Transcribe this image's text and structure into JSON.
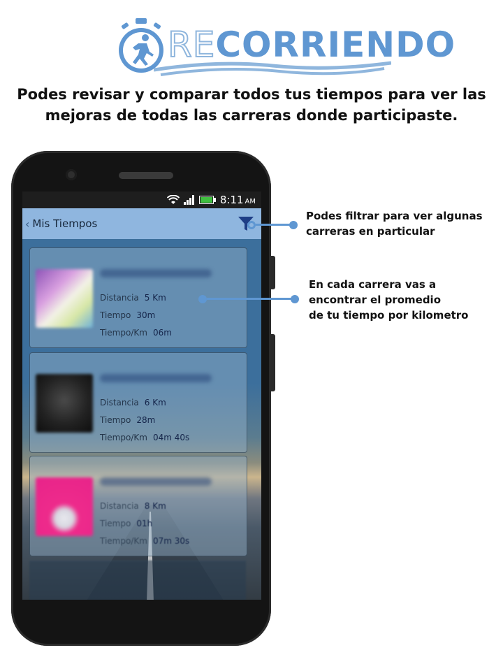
{
  "logo": {
    "text_re": "RE",
    "text_main": "CORRIENDO",
    "icon": "stopwatch-runner-icon",
    "brand_color": "#5f97d2"
  },
  "headline": "Podes revisar y comparar todos tus tiempos para ver las mejoras de todas las carreras donde participaste.",
  "statusbar": {
    "time": "8:11",
    "ampm": "AM",
    "icons": [
      "wifi-icon",
      "signal-icon",
      "battery-icon"
    ]
  },
  "appbar": {
    "back_icon": "chevron-left-icon",
    "title": "Mis Tiempos",
    "filter_icon": "filter-icon",
    "color": "#8fb6df"
  },
  "races": [
    {
      "distancia_label": "Distancia",
      "distancia": "5 Km",
      "tiempo_label": "Tiempo",
      "tiempo": "30m",
      "tpk_label": "Tiempo/Km",
      "tpk": "06m"
    },
    {
      "distancia_label": "Distancia",
      "distancia": "6 Km",
      "tiempo_label": "Tiempo",
      "tiempo": "28m",
      "tpk_label": "Tiempo/Km",
      "tpk": "04m 40s"
    },
    {
      "distancia_label": "Distancia",
      "distancia": "8 Km",
      "tiempo_label": "Tiempo",
      "tiempo": "01h",
      "tpk_label": "Tiempo/Km",
      "tpk": "07m 30s"
    }
  ],
  "callouts": {
    "filter": [
      "Podes filtrar para ver algunas",
      "carreras en particular"
    ],
    "average": [
      "En cada carrera vas a",
      "encontrar el promedio",
      "de tu tiempo por kilometro"
    ]
  }
}
